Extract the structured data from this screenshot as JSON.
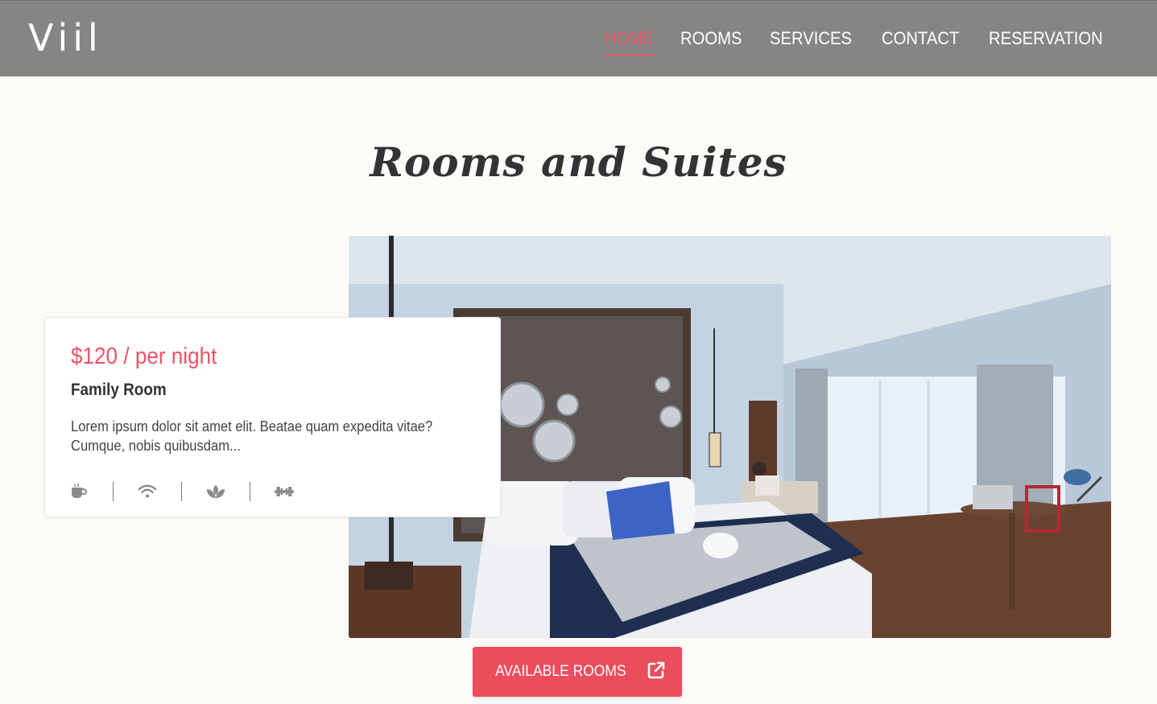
{
  "header": {
    "logo": "Viil",
    "nav": [
      {
        "label": "HOME",
        "active": true
      },
      {
        "label": "ROOMS",
        "active": false
      },
      {
        "label": "SERVICES",
        "active": false
      },
      {
        "label": "CONTACT",
        "active": false
      },
      {
        "label": "RESERVATION",
        "active": false
      }
    ]
  },
  "section": {
    "title": "Rooms and Suites"
  },
  "room": {
    "price": "$120 / per night",
    "name": "Family Room",
    "description": "Lorem ipsum dolor sit amet elit. Beatae quam expedita vitae? Cumque, nobis quibusdam...",
    "amenities": [
      "coffee-icon",
      "wifi-icon",
      "spa-icon",
      "gym-icon"
    ]
  },
  "cta": {
    "label": "AVAILABLE ROOMS",
    "icon": "external-link-icon"
  },
  "colors": {
    "accent": "#eb4d5c",
    "header_bg": "#858583",
    "page_bg": "#fdfbf8"
  }
}
